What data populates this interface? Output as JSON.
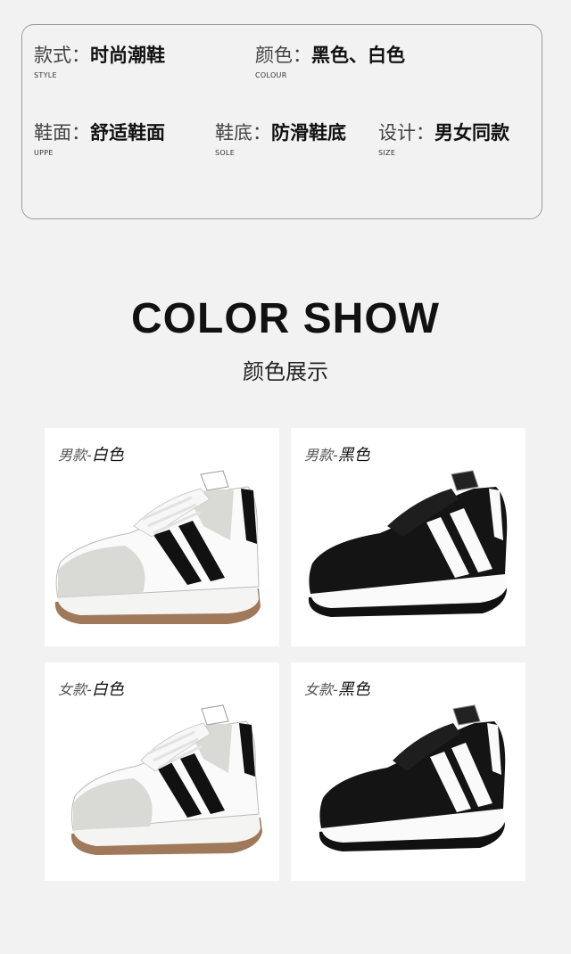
{
  "specs": [
    {
      "key": "款式：",
      "value": "时尚潮鞋",
      "en": "STYLE"
    },
    {
      "key": "颜色：",
      "value": "黑色、白色",
      "en": "COLOUR"
    },
    {
      "key": "鞋面：",
      "value": "舒适鞋面",
      "en": "UPPE"
    },
    {
      "key": "鞋底：",
      "value": "防滑鞋底",
      "en": "SOLE"
    },
    {
      "key": "设计：",
      "value": "男女同款",
      "en": "SIZE"
    }
  ],
  "color_show": {
    "title": "COLOR SHOW",
    "subtitle": "颜色展示"
  },
  "products": [
    {
      "gender": "男款-",
      "color": "白色",
      "shoe_color": "white"
    },
    {
      "gender": "男款-",
      "color": "黑色",
      "shoe_color": "black"
    },
    {
      "gender": "女款-",
      "color": "白色",
      "shoe_color": "white"
    },
    {
      "gender": "女款-",
      "color": "黑色",
      "shoe_color": "black"
    }
  ],
  "colors": {
    "background": "#f2f2f2",
    "card": "#ffffff",
    "gum_sole": "#a0785a",
    "suede": "#d9d9d6"
  }
}
